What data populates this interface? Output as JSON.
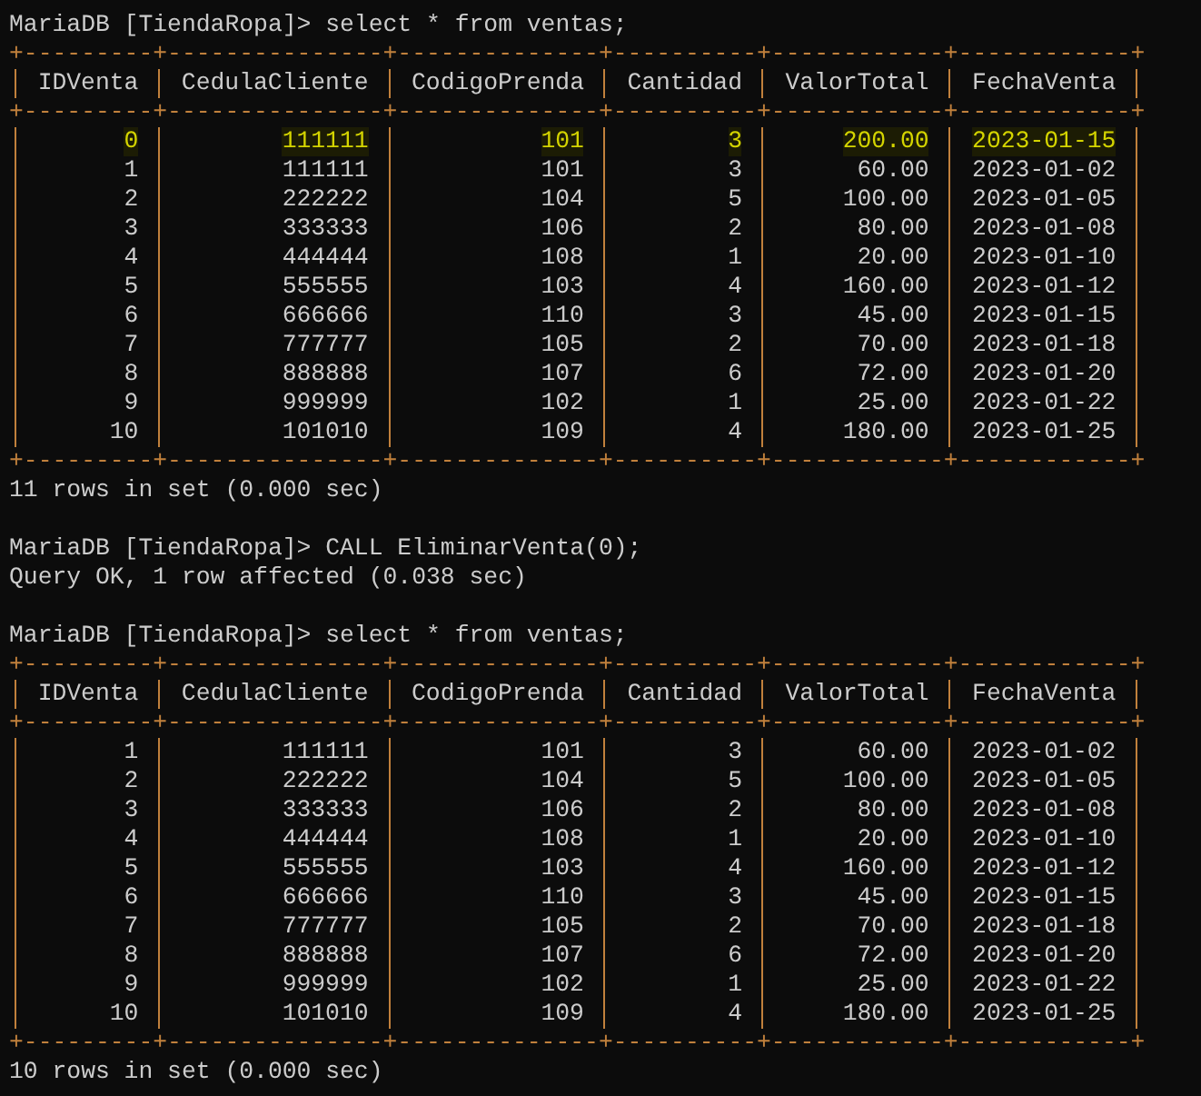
{
  "terminal": {
    "blocks": [
      {
        "kind": "command",
        "text": "MariaDB [TiendaRopa]> select * from ventas;"
      },
      {
        "kind": "table",
        "top_border": "+---------+---------------+--------------+----------+------------+------------+",
        "header_border": "+---------+---------------+--------------+----------+------------+------------+",
        "bottom_border": "+---------+---------------+--------------+----------+------------+------------+",
        "columns": [
          {
            "label": "IDVenta"
          },
          {
            "label": "CedulaCliente"
          },
          {
            "label": "CodigoPrenda"
          },
          {
            "label": "Cantidad"
          },
          {
            "label": "ValorTotal"
          },
          {
            "label": "FechaVenta"
          }
        ],
        "rows": [
          {
            "highlighted": true,
            "cells": [
              "0",
              "111111",
              "101",
              "3",
              "200.00",
              "2023-01-15"
            ]
          },
          {
            "highlighted": false,
            "cells": [
              "1",
              "111111",
              "101",
              "3",
              "60.00",
              "2023-01-02"
            ]
          },
          {
            "highlighted": false,
            "cells": [
              "2",
              "222222",
              "104",
              "5",
              "100.00",
              "2023-01-05"
            ]
          },
          {
            "highlighted": false,
            "cells": [
              "3",
              "333333",
              "106",
              "2",
              "80.00",
              "2023-01-08"
            ]
          },
          {
            "highlighted": false,
            "cells": [
              "4",
              "444444",
              "108",
              "1",
              "20.00",
              "2023-01-10"
            ]
          },
          {
            "highlighted": false,
            "cells": [
              "5",
              "555555",
              "103",
              "4",
              "160.00",
              "2023-01-12"
            ]
          },
          {
            "highlighted": false,
            "cells": [
              "6",
              "666666",
              "110",
              "3",
              "45.00",
              "2023-01-15"
            ]
          },
          {
            "highlighted": false,
            "cells": [
              "7",
              "777777",
              "105",
              "2",
              "70.00",
              "2023-01-18"
            ]
          },
          {
            "highlighted": false,
            "cells": [
              "8",
              "888888",
              "107",
              "6",
              "72.00",
              "2023-01-20"
            ]
          },
          {
            "highlighted": false,
            "cells": [
              "9",
              "999999",
              "102",
              "1",
              "25.00",
              "2023-01-22"
            ]
          },
          {
            "highlighted": false,
            "cells": [
              "10",
              "101010",
              "109",
              "4",
              "180.00",
              "2023-01-25"
            ]
          }
        ]
      },
      {
        "kind": "text",
        "text": "11 rows in set (0.000 sec)"
      },
      {
        "kind": "blank"
      },
      {
        "kind": "command",
        "text": "MariaDB [TiendaRopa]> CALL EliminarVenta(0);"
      },
      {
        "kind": "text",
        "text": "Query OK, 1 row affected (0.038 sec)"
      },
      {
        "kind": "blank"
      },
      {
        "kind": "command",
        "text": "MariaDB [TiendaRopa]> select * from ventas;"
      },
      {
        "kind": "table",
        "top_border": "+---------+---------------+--------------+----------+------------+------------+",
        "header_border": "+---------+---------------+--------------+----------+------------+------------+",
        "bottom_border": "+---------+---------------+--------------+----------+------------+------------+",
        "columns": [
          {
            "label": "IDVenta"
          },
          {
            "label": "CedulaCliente"
          },
          {
            "label": "CodigoPrenda"
          },
          {
            "label": "Cantidad"
          },
          {
            "label": "ValorTotal"
          },
          {
            "label": "FechaVenta"
          }
        ],
        "rows": [
          {
            "highlighted": false,
            "cells": [
              "1",
              "111111",
              "101",
              "3",
              "60.00",
              "2023-01-02"
            ]
          },
          {
            "highlighted": false,
            "cells": [
              "2",
              "222222",
              "104",
              "5",
              "100.00",
              "2023-01-05"
            ]
          },
          {
            "highlighted": false,
            "cells": [
              "3",
              "333333",
              "106",
              "2",
              "80.00",
              "2023-01-08"
            ]
          },
          {
            "highlighted": false,
            "cells": [
              "4",
              "444444",
              "108",
              "1",
              "20.00",
              "2023-01-10"
            ]
          },
          {
            "highlighted": false,
            "cells": [
              "5",
              "555555",
              "103",
              "4",
              "160.00",
              "2023-01-12"
            ]
          },
          {
            "highlighted": false,
            "cells": [
              "6",
              "666666",
              "110",
              "3",
              "45.00",
              "2023-01-15"
            ]
          },
          {
            "highlighted": false,
            "cells": [
              "7",
              "777777",
              "105",
              "2",
              "70.00",
              "2023-01-18"
            ]
          },
          {
            "highlighted": false,
            "cells": [
              "8",
              "888888",
              "107",
              "6",
              "72.00",
              "2023-01-20"
            ]
          },
          {
            "highlighted": false,
            "cells": [
              "9",
              "999999",
              "102",
              "1",
              "25.00",
              "2023-01-22"
            ]
          },
          {
            "highlighted": false,
            "cells": [
              "10",
              "101010",
              "109",
              "4",
              "180.00",
              "2023-01-25"
            ]
          }
        ]
      },
      {
        "kind": "text",
        "text": "10 rows in set (0.000 sec)"
      }
    ]
  }
}
